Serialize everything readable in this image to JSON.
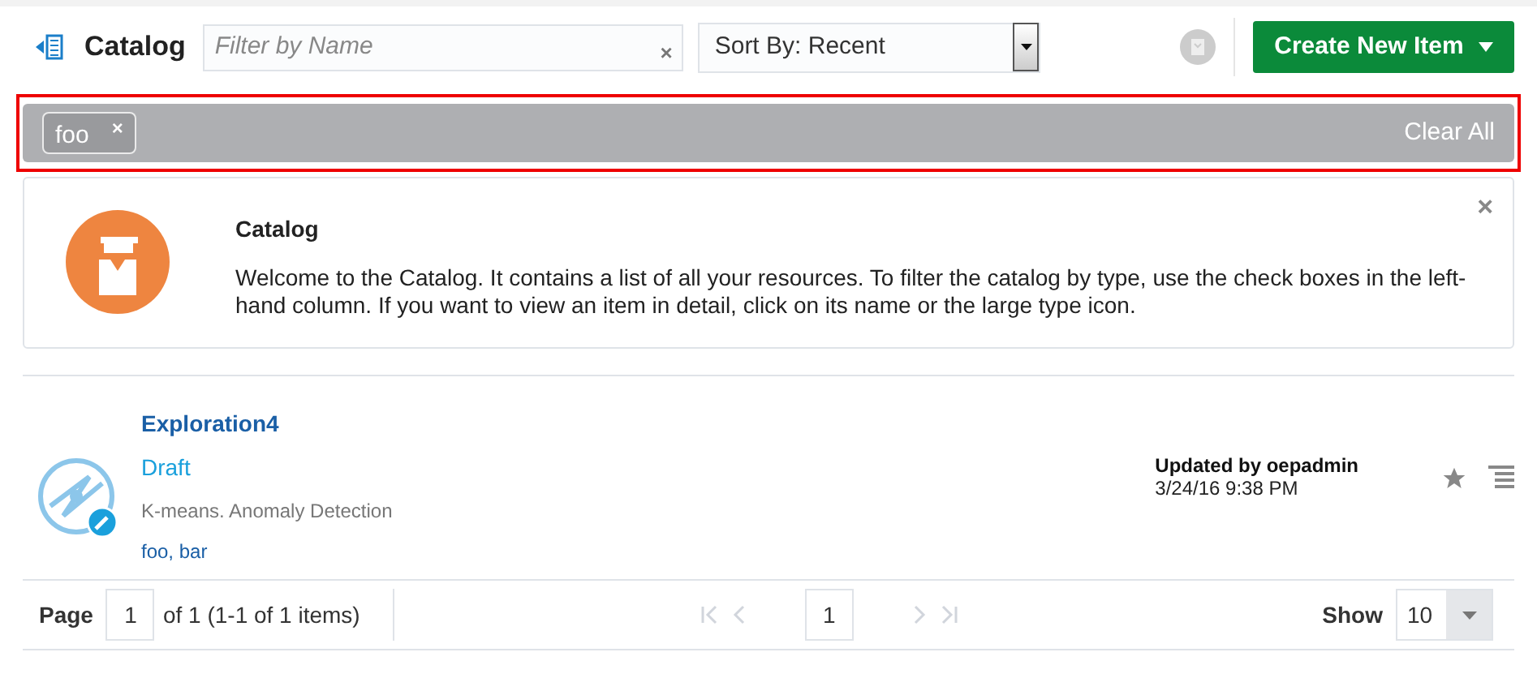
{
  "header": {
    "title": "Catalog",
    "filter": {
      "placeholder": "Filter by Name",
      "clear": "×"
    },
    "sort": {
      "value": "Sort By: Recent"
    },
    "create_button": {
      "label": "Create New Item"
    }
  },
  "filter_bar": {
    "chips": [
      {
        "label": "foo",
        "remove": "×"
      }
    ],
    "clear_all": "Clear All"
  },
  "info_card": {
    "title": "Catalog",
    "text": "Welcome to the Catalog. It contains a list of all your resources. To filter the catalog by type, use the check boxes in the left-hand column. If you want to view an item in detail, click on its name or the large type icon.",
    "close": "×"
  },
  "items": [
    {
      "name": "Exploration4",
      "status": "Draft",
      "description": "K-means. Anomaly Detection",
      "tags": "foo, bar",
      "updated_by": "Updated by oepadmin",
      "updated_at": "3/24/16 9:38 PM",
      "favorite": false
    }
  ],
  "pagination": {
    "page_label": "Page",
    "page": "1",
    "page_info": "of 1 (1-1 of 1 items)",
    "current": "1",
    "show_label": "Show",
    "show": "10"
  }
}
